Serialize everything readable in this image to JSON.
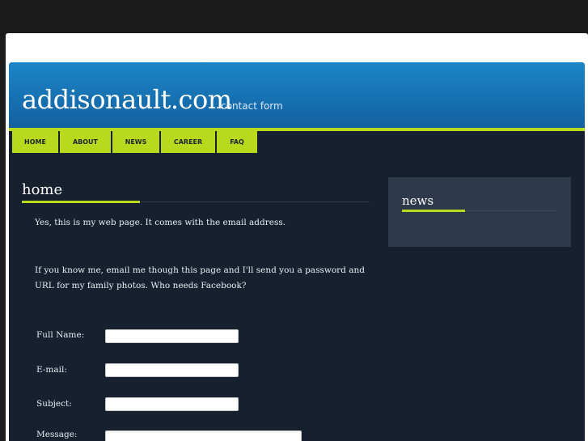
{
  "site": {
    "title": "addisonault.com",
    "subtitle": "contact form"
  },
  "nav": {
    "items": [
      {
        "label": "HOME"
      },
      {
        "label": "ABOUT"
      },
      {
        "label": "NEWS"
      },
      {
        "label": "CAREER"
      },
      {
        "label": "FAQ"
      }
    ]
  },
  "content": {
    "heading": "home",
    "paragraph1": "Yes, this is my web page.  It comes with the email address.",
    "paragraph2": "If you know me, email me though this page and I'll send you a password and URL for my family photos.  Who needs Facebook?"
  },
  "form": {
    "full_name_label": "Full Name:",
    "full_name_value": "",
    "email_label": "E-mail:",
    "email_value": "",
    "subject_label": "Subject:",
    "subject_value": "",
    "message_label": "Message:",
    "message_value": ""
  },
  "sidebar": {
    "heading": "news"
  },
  "colors": {
    "accent": "#b9d91d",
    "header_top": "#1b86c7",
    "header_bottom": "#1360a0",
    "page_bg": "#16202e",
    "sidebar_bg": "#2e3a4b"
  }
}
